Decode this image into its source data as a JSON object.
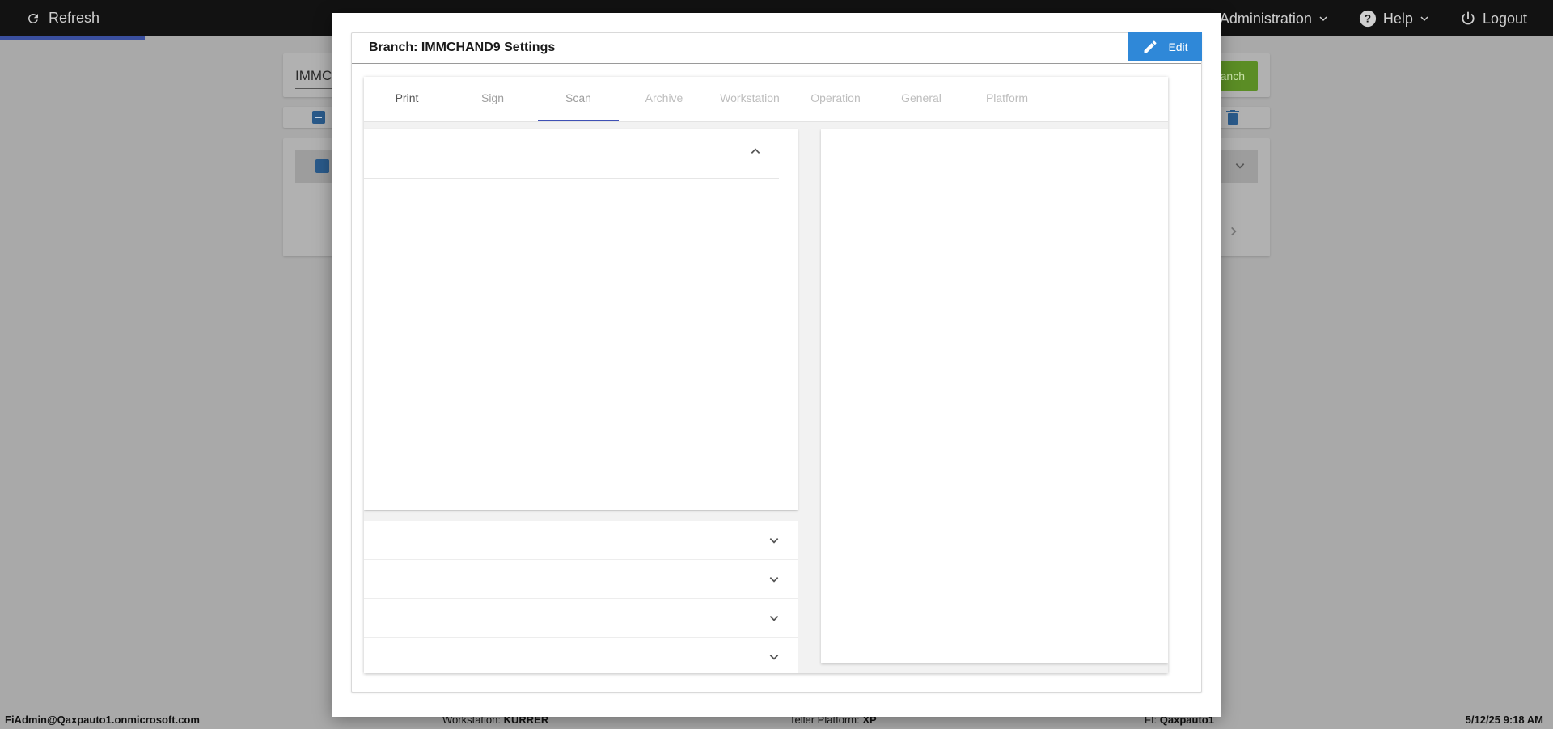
{
  "topbar": {
    "refresh_label": "Refresh",
    "administration_label": "Administration",
    "help_label": "Help",
    "logout_label": "Logout"
  },
  "background": {
    "search_value": "IMMCH",
    "search_button_label": "anch"
  },
  "modal": {
    "title": "Branch: IMMCHAND9 Settings",
    "edit_label": "Edit",
    "tabs": [
      {
        "label": "Print"
      },
      {
        "label": "Sign"
      },
      {
        "label": "Scan"
      },
      {
        "label": "Archive"
      },
      {
        "label": "Workstation"
      },
      {
        "label": "Operation"
      },
      {
        "label": "General"
      },
      {
        "label": "Platform"
      }
    ],
    "active_tab": "Scan"
  },
  "statusbar": {
    "user": "FiAdmin@Qaxpauto1.onmicrosoft.com",
    "workstation_label": "Workstation:",
    "workstation_value": "KURRER",
    "platform_label": "Teller Platform:",
    "platform_value": "XP",
    "fi_label": "FI:",
    "fi_value": "Qaxpauto1",
    "datetime": "5/12/25 9:18 AM"
  },
  "colors": {
    "edit_button": "#2f88d8",
    "active_tab_underline": "#3f51b5",
    "topbar": "#121212",
    "search_button": "#5b8d25"
  }
}
